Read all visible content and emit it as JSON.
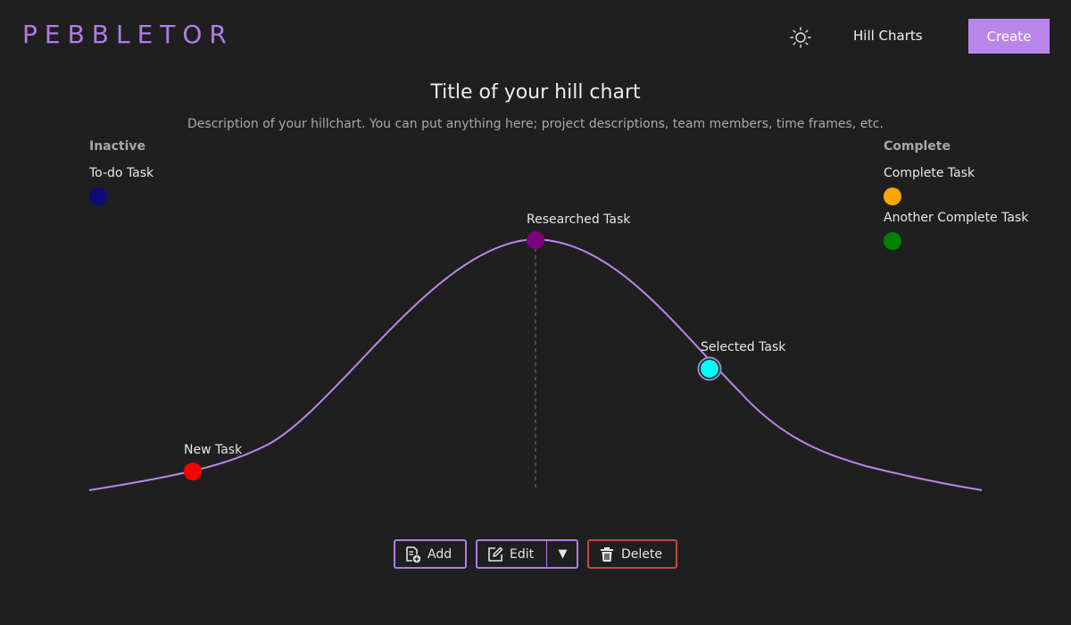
{
  "header": {
    "logo": "PEBBLETOR",
    "nav_link": "Hill Charts",
    "create_label": "Create",
    "theme_icon": "sun-icon"
  },
  "chart": {
    "title": "Title of your hill chart",
    "description": "Description of your hillchart. You can put anything here; project descriptions, team members, time frames, etc."
  },
  "inactive": {
    "heading": "Inactive",
    "tasks": [
      {
        "label": "To-do Task",
        "color": "#0b0b7a"
      }
    ]
  },
  "complete": {
    "heading": "Complete",
    "tasks": [
      {
        "label": "Complete Task",
        "color": "#ffa500"
      },
      {
        "label": "Another Complete Task",
        "color": "#008000"
      }
    ]
  },
  "hill_tasks": [
    {
      "label": "New Task",
      "color": "#ff0000",
      "selected": false
    },
    {
      "label": "Researched Task",
      "color": "#800080",
      "selected": false
    },
    {
      "label": "Selected Task",
      "color": "#00ffff",
      "selected": true
    }
  ],
  "colors": {
    "accent": "#b07ce8",
    "danger": "#c24848",
    "background": "#1f1f1f"
  },
  "toolbar": {
    "add_label": "Add",
    "edit_label": "Edit",
    "delete_label": "Delete",
    "add_icon": "file-add-icon",
    "edit_icon": "edit-icon",
    "delete_icon": "trash-icon",
    "caret_icon": "caret-down-icon"
  }
}
